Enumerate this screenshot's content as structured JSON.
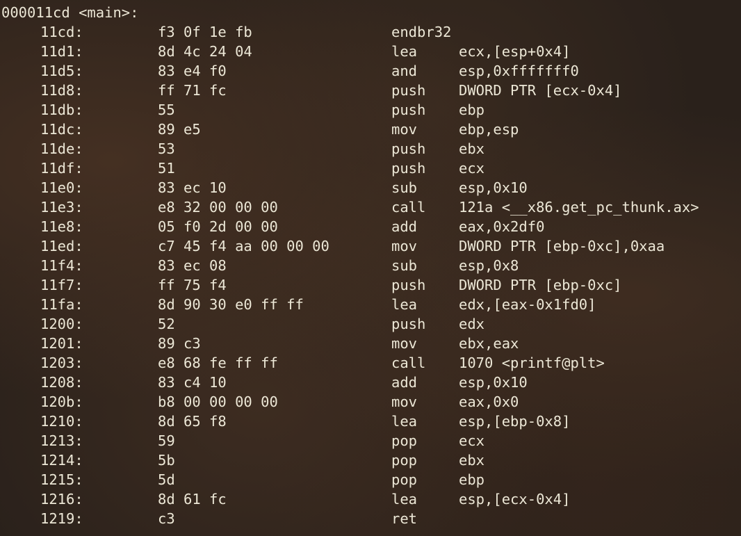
{
  "header": "000011cd <main>:",
  "rows": [
    {
      "addr": "11cd:",
      "bytes": "f3 0f 1e fb",
      "mnem": "endbr32",
      "ops": ""
    },
    {
      "addr": "11d1:",
      "bytes": "8d 4c 24 04",
      "mnem": "lea",
      "ops": "ecx,[esp+0x4]"
    },
    {
      "addr": "11d5:",
      "bytes": "83 e4 f0",
      "mnem": "and",
      "ops": "esp,0xfffffff0"
    },
    {
      "addr": "11d8:",
      "bytes": "ff 71 fc",
      "mnem": "push",
      "ops": "DWORD PTR [ecx-0x4]"
    },
    {
      "addr": "11db:",
      "bytes": "55",
      "mnem": "push",
      "ops": "ebp"
    },
    {
      "addr": "11dc:",
      "bytes": "89 e5",
      "mnem": "mov",
      "ops": "ebp,esp"
    },
    {
      "addr": "11de:",
      "bytes": "53",
      "mnem": "push",
      "ops": "ebx"
    },
    {
      "addr": "11df:",
      "bytes": "51",
      "mnem": "push",
      "ops": "ecx"
    },
    {
      "addr": "11e0:",
      "bytes": "83 ec 10",
      "mnem": "sub",
      "ops": "esp,0x10"
    },
    {
      "addr": "11e3:",
      "bytes": "e8 32 00 00 00",
      "mnem": "call",
      "ops": "121a <__x86.get_pc_thunk.ax>"
    },
    {
      "addr": "11e8:",
      "bytes": "05 f0 2d 00 00",
      "mnem": "add",
      "ops": "eax,0x2df0"
    },
    {
      "addr": "11ed:",
      "bytes": "c7 45 f4 aa 00 00 00",
      "mnem": "mov",
      "ops": "DWORD PTR [ebp-0xc],0xaa"
    },
    {
      "addr": "11f4:",
      "bytes": "83 ec 08",
      "mnem": "sub",
      "ops": "esp,0x8"
    },
    {
      "addr": "11f7:",
      "bytes": "ff 75 f4",
      "mnem": "push",
      "ops": "DWORD PTR [ebp-0xc]"
    },
    {
      "addr": "11fa:",
      "bytes": "8d 90 30 e0 ff ff",
      "mnem": "lea",
      "ops": "edx,[eax-0x1fd0]"
    },
    {
      "addr": "1200:",
      "bytes": "52",
      "mnem": "push",
      "ops": "edx"
    },
    {
      "addr": "1201:",
      "bytes": "89 c3",
      "mnem": "mov",
      "ops": "ebx,eax"
    },
    {
      "addr": "1203:",
      "bytes": "e8 68 fe ff ff",
      "mnem": "call",
      "ops": "1070 <printf@plt>"
    },
    {
      "addr": "1208:",
      "bytes": "83 c4 10",
      "mnem": "add",
      "ops": "esp,0x10"
    },
    {
      "addr": "120b:",
      "bytes": "b8 00 00 00 00",
      "mnem": "mov",
      "ops": "eax,0x0"
    },
    {
      "addr": "1210:",
      "bytes": "8d 65 f8",
      "mnem": "lea",
      "ops": "esp,[ebp-0x8]"
    },
    {
      "addr": "1213:",
      "bytes": "59",
      "mnem": "pop",
      "ops": "ecx"
    },
    {
      "addr": "1214:",
      "bytes": "5b",
      "mnem": "pop",
      "ops": "ebx"
    },
    {
      "addr": "1215:",
      "bytes": "5d",
      "mnem": "pop",
      "ops": "ebp"
    },
    {
      "addr": "1216:",
      "bytes": "8d 61 fc",
      "mnem": "lea",
      "ops": "esp,[ecx-0x4]"
    },
    {
      "addr": "1219:",
      "bytes": "c3",
      "mnem": "ret",
      "ops": ""
    }
  ]
}
